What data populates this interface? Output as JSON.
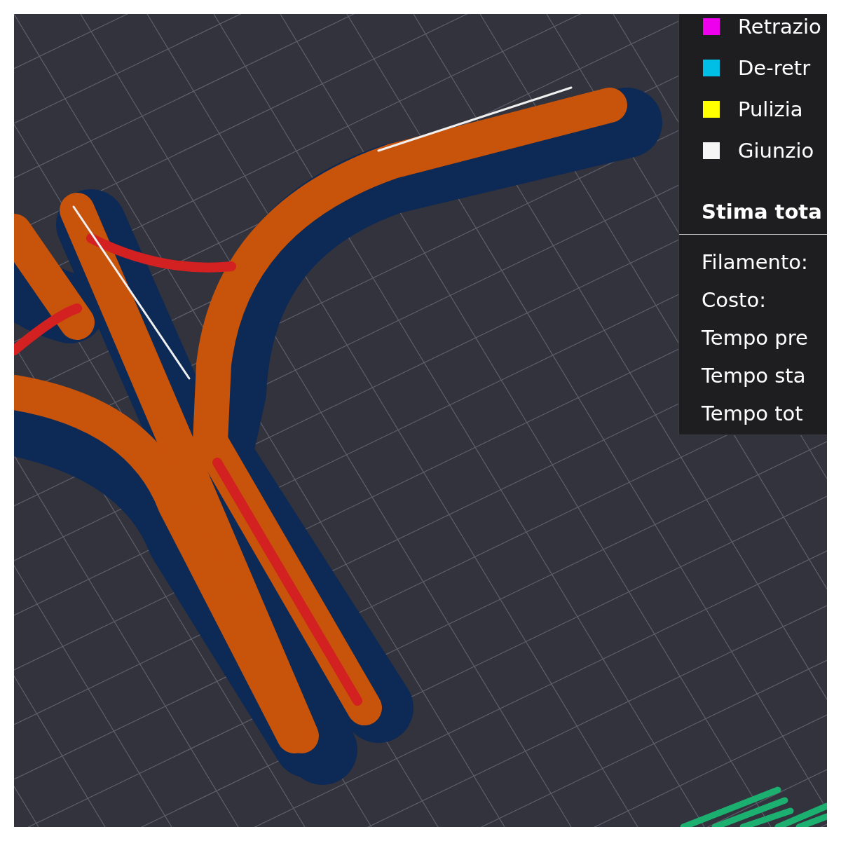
{
  "legend": {
    "items": [
      {
        "label": "Retrazio",
        "color": "#ee00ee"
      },
      {
        "label": "De-retr",
        "color": "#00bfe6"
      },
      {
        "label": "Pulizia",
        "color": "#ffff00"
      },
      {
        "label": "Giunzio",
        "color": "#f5f5f5"
      }
    ]
  },
  "estimate": {
    "title": "Stima tota",
    "rows": [
      "Filamento:",
      "Costo:",
      "Tempo pre",
      "Tempo sta",
      "Tempo tot"
    ]
  }
}
